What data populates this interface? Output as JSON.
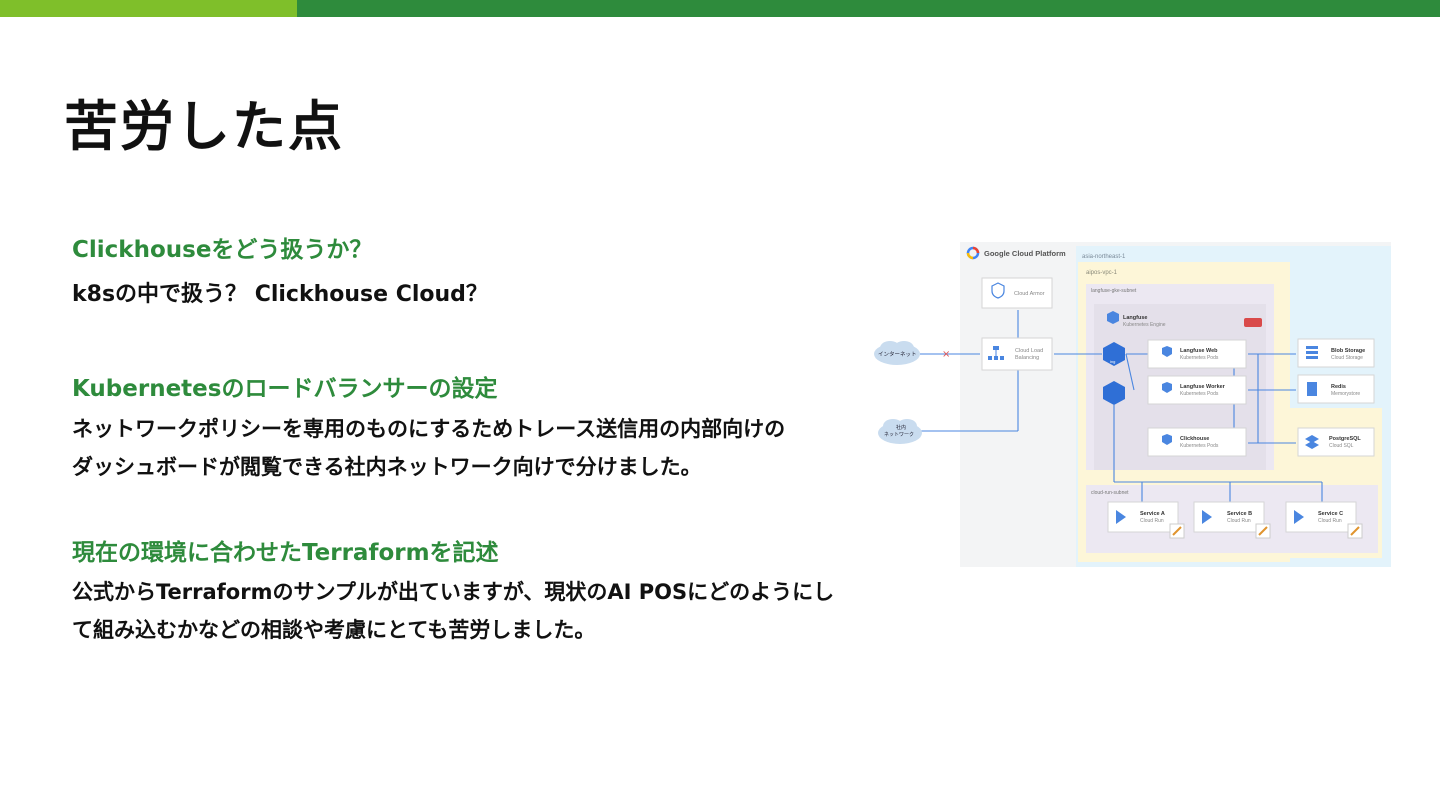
{
  "slide": {
    "title": "苦労した点"
  },
  "sections": [
    {
      "heading": "Clickhouseをどう扱うか？",
      "lines": [
        "k8sの中で扱う？ Clickhouse Cloud？"
      ]
    },
    {
      "heading": "Kubernetesのロードバランサーの設定",
      "lines": [
        "ネットワークポリシーを専用のものにするためトレース送信用の内部向けの",
        "ダッシュボードが閲覧できる社内ネットワーク向けで分けました。"
      ]
    },
    {
      "heading": "現在の環境に合わせたTerraformを記述",
      "lines": [
        "公式からTerraformのサンプルが出ていますが、現状のAI POSにどのようにし",
        "て組み込むかなどの相談や考慮にとても苦労しました。"
      ]
    }
  ],
  "diagram": {
    "platform_label": "Google Cloud Platform",
    "region_label": "asia-northeast-1",
    "vpc_label": "aipos-vpc-1",
    "subnet_gke_label": "langfuse-gke-subnet",
    "subnet_run_label": "cloud-run-subnet",
    "internet_label": "インターネット",
    "internal_label_1": "社内",
    "internal_label_2": "ネットワーク",
    "cloud_armor": "Cloud Armor",
    "cloud_lb_1": "Cloud Load",
    "cloud_lb_2": "Balancing",
    "gke_title": "Langfuse",
    "gke_sub": "Kubernetes Engine",
    "langfuse_web": "Langfuse Web",
    "langfuse_worker": "Langfuse Worker",
    "clickhouse": "Clickhouse",
    "pods_sub": "Kubernetes Pods",
    "blob_storage": "Blob Storage",
    "cloud_storage": "Cloud Storage",
    "redis": "Redis",
    "memorystore": "Memorystore",
    "postgresql": "PostgreSQL",
    "cloud_sql": "Cloud SQL",
    "service_a": "Service A",
    "service_b": "Service B",
    "service_c": "Service C",
    "cloud_run": "Cloud Run",
    "ing_label": "ing",
    "colors": {
      "gcp_bg": "#f3f4f5",
      "region_bg": "#e3f3fb",
      "vpc_bg": "#fdf6d8",
      "subnet_bg": "#ece8f2",
      "line": "#4a86e0"
    }
  }
}
